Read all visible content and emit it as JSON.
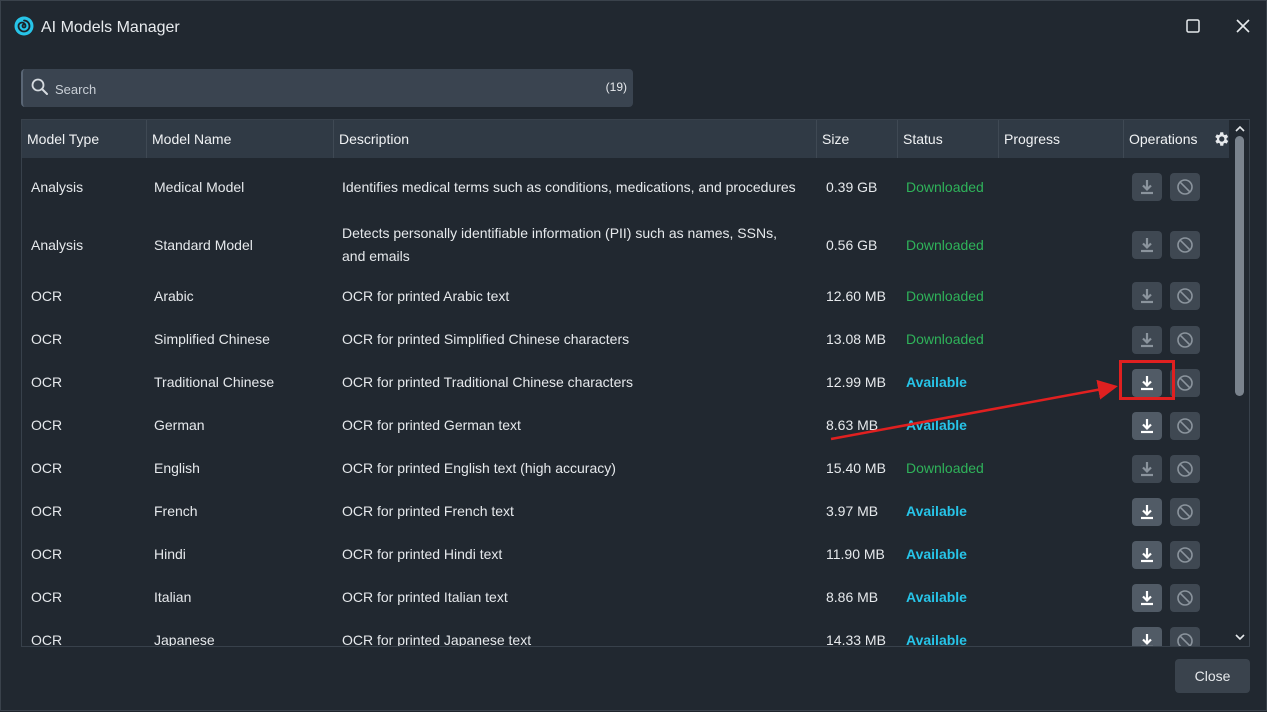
{
  "window": {
    "title": "AI Models Manager"
  },
  "search": {
    "placeholder": "Search",
    "count": "(19)"
  },
  "columns": [
    "Model Type",
    "Model Name",
    "Description",
    "Size",
    "Status",
    "Progress",
    "Operations"
  ],
  "rows": [
    {
      "type": "Analysis",
      "name": "Medical Model",
      "description": "Identifies medical terms such as conditions, medications, and procedures",
      "size": "0.39 GB",
      "status": "Downloaded"
    },
    {
      "type": "Analysis",
      "name": "Standard Model",
      "description": "Detects personally identifiable information (PII) such as names, SSNs, and emails",
      "size": "0.56 GB",
      "status": "Downloaded"
    },
    {
      "type": "OCR",
      "name": "Arabic",
      "description": "OCR for printed Arabic text",
      "size": "12.60 MB",
      "status": "Downloaded"
    },
    {
      "type": "OCR",
      "name": "Simplified Chinese",
      "description": "OCR for printed Simplified Chinese characters",
      "size": "13.08 MB",
      "status": "Downloaded"
    },
    {
      "type": "OCR",
      "name": "Traditional Chinese",
      "description": "OCR for printed Traditional Chinese characters",
      "size": "12.99 MB",
      "status": "Available"
    },
    {
      "type": "OCR",
      "name": "German",
      "description": "OCR for printed German text",
      "size": "8.63 MB",
      "status": "Available"
    },
    {
      "type": "OCR",
      "name": "English",
      "description": "OCR for printed English text (high accuracy)",
      "size": "15.40 MB",
      "status": "Downloaded"
    },
    {
      "type": "OCR",
      "name": "French",
      "description": "OCR for printed French text",
      "size": "3.97 MB",
      "status": "Available"
    },
    {
      "type": "OCR",
      "name": "Hindi",
      "description": "OCR for printed Hindi text",
      "size": "11.90 MB",
      "status": "Available"
    },
    {
      "type": "OCR",
      "name": "Italian",
      "description": "OCR for printed Italian text",
      "size": "8.86 MB",
      "status": "Available"
    },
    {
      "type": "OCR",
      "name": "Japanese",
      "description": "OCR for printed Japanese text",
      "size": "14.33 MB",
      "status": "Available"
    }
  ],
  "footer": {
    "close_label": "Close"
  },
  "colors": {
    "downloaded": "#2fb35a",
    "available": "#27c4e8",
    "annotation": "#e02020",
    "accent": "#27c4e8"
  },
  "icons": {
    "logo": "swirl-logo-icon",
    "maximize": "maximize-icon",
    "close": "close-x-icon",
    "search": "search-icon",
    "settings": "gear-icon",
    "download": "download-icon",
    "cancel": "cancel-circle-icon"
  }
}
